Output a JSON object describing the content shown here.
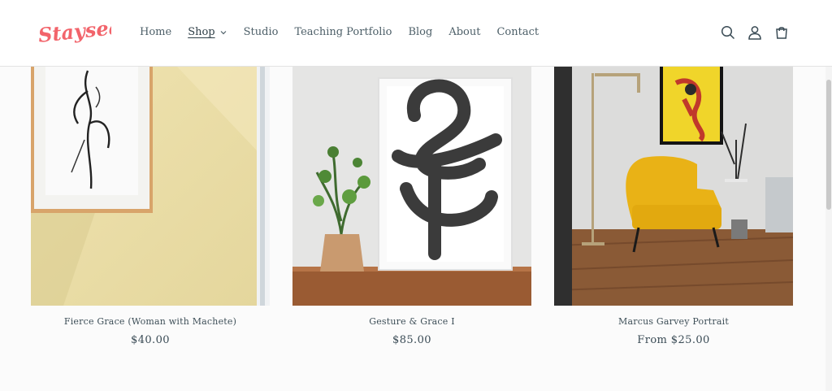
{
  "brand": {
    "logo_text": "Stayseann",
    "logo_color": "#f2646b"
  },
  "nav": {
    "items": [
      {
        "label": "Home"
      },
      {
        "label": "Shop"
      },
      {
        "label": "Studio"
      },
      {
        "label": "Teaching Portfolio"
      },
      {
        "label": "Blog"
      },
      {
        "label": "About"
      },
      {
        "label": "Contact"
      }
    ],
    "active": "Shop"
  },
  "header_icons": [
    "search-icon",
    "account-icon",
    "cart-icon"
  ],
  "products": [
    {
      "title": "Fierce Grace (Woman with Machete)",
      "price": "$40.00"
    },
    {
      "title": "Gesture & Grace I",
      "price": "$85.00"
    },
    {
      "title": "Marcus Garvey Portrait",
      "price": "From $25.00"
    }
  ]
}
